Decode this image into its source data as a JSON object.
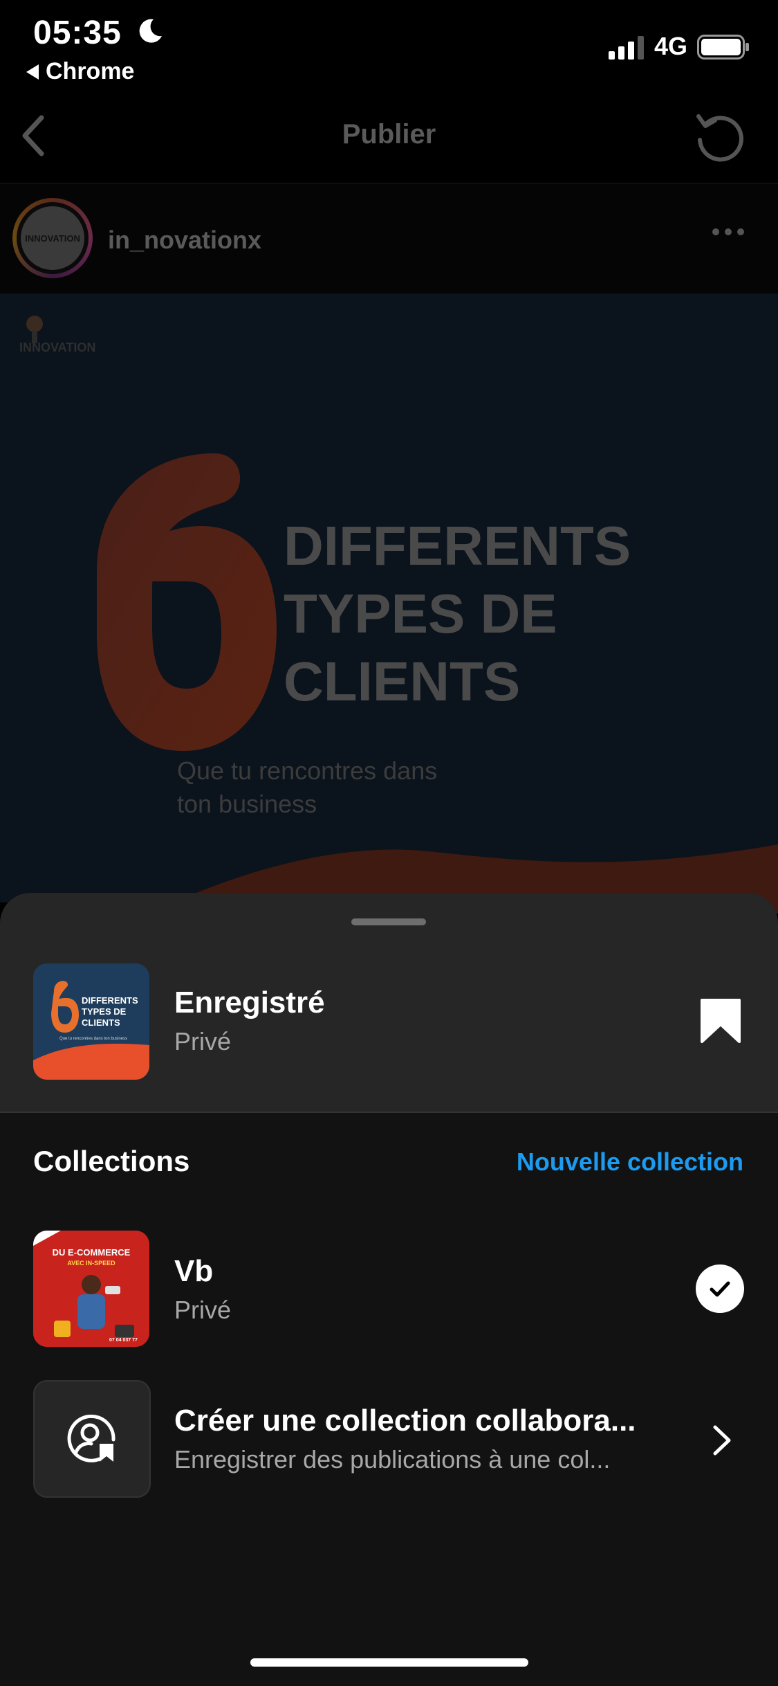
{
  "status_bar": {
    "time": "05:35",
    "back_app": "Chrome",
    "network": "4G"
  },
  "header": {
    "title": "Publier"
  },
  "post": {
    "username": "in_novationx",
    "headline_lines": [
      "DIFFERENTS",
      "TYPES DE",
      "CLIENTS"
    ],
    "subline_lines": [
      "Que tu rencontres dans",
      "ton business"
    ],
    "logo_text": "INNOVATION"
  },
  "sheet": {
    "saved": {
      "title": "Enregistré",
      "subtitle": "Privé",
      "thumb_lines": [
        "DIFFERENTS",
        "TYPES DE",
        "CLIENTS"
      ],
      "thumb_sub": "Que tu rencontres dans ton business"
    },
    "collections_heading": "Collections",
    "new_collection": "Nouvelle collection",
    "items": [
      {
        "title": "Vb",
        "subtitle": "Privé",
        "thumb_text": [
          "DU E-COMMERCE",
          "AVEC IN-SPEED"
        ],
        "thumb_phone": "07 04 037 77",
        "selected": true
      }
    ],
    "collab": {
      "title": "Créer une collection collabora...",
      "subtitle": "Enregistrer des publications à une col..."
    }
  },
  "colors": {
    "accent_blue": "#1c9bf0",
    "sheet_bg": "#262626",
    "list_bg": "#121212",
    "post_orange": "#e8502c"
  }
}
